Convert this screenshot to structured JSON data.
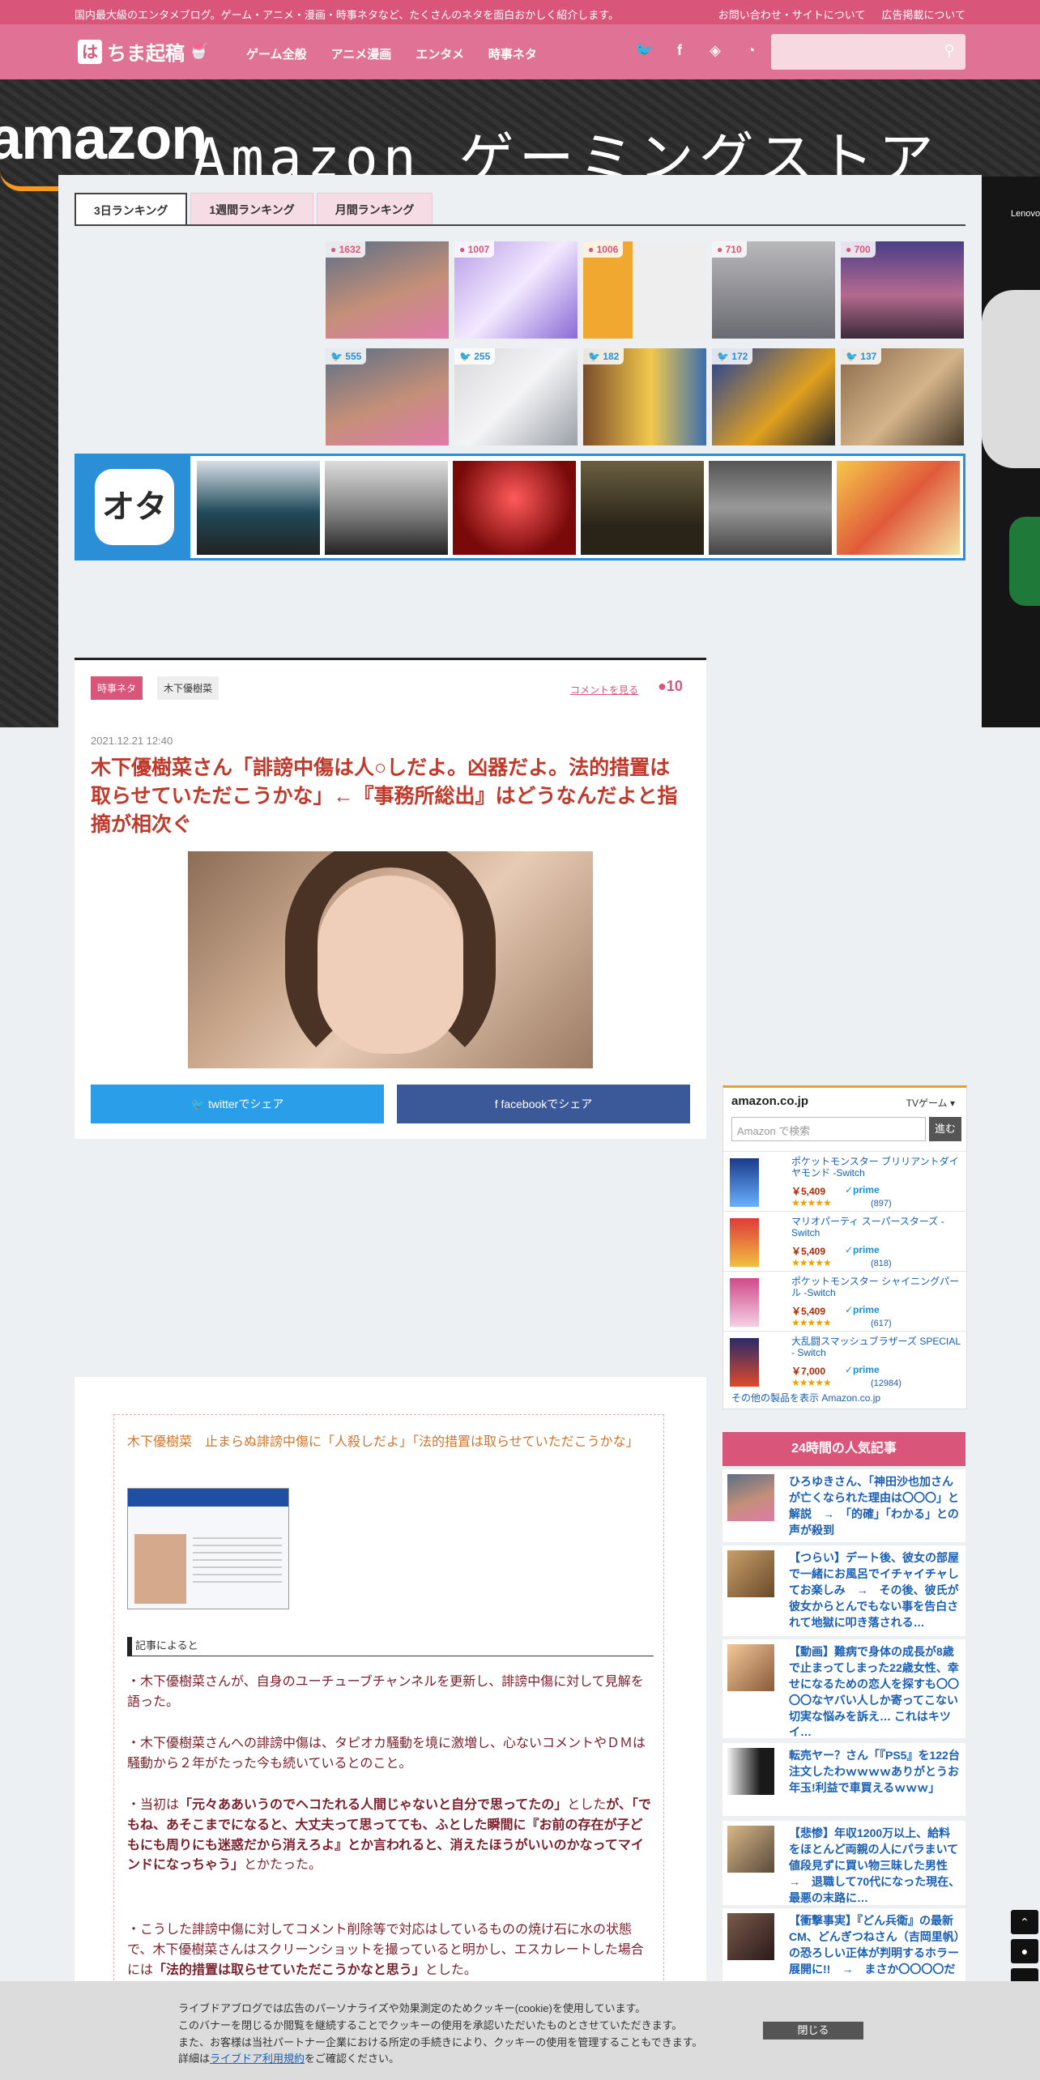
{
  "topbar": {
    "tagline": "国内最大級のエンタメブログ。ゲーム・アニメ・漫画・時事ネタなど、たくさんのネタを面白おかしく紹介します。",
    "contact": "お問い合わせ・サイトについて",
    "ads": "広告掲載について"
  },
  "header": {
    "logo_mark": "は",
    "logo_text": "ちま起稿",
    "nav": [
      "ゲーム全般",
      "アニメ漫画",
      "エンタメ",
      "時事ネタ"
    ],
    "social": [
      "twitter-icon",
      "facebook-icon",
      "feedly-icon",
      "rss-icon"
    ],
    "search_placeholder": ""
  },
  "banner": {
    "brand": "amazon",
    "headline": "Amazon ゲーミングストア",
    "side_label": "Lenovo"
  },
  "ranking": {
    "tabs": [
      "3日ランキング",
      "1週間ランキング",
      "月間ランキング"
    ],
    "comment_counts": [
      "1632",
      "1007",
      "1006",
      "710",
      "700"
    ],
    "twitter_counts": [
      "555",
      "255",
      "182",
      "172",
      "137"
    ],
    "strip_brand": "オタ"
  },
  "article": {
    "categories": [
      "時事ネタ",
      "木下優樹菜"
    ],
    "comment_link": "コメントを見る",
    "comment_count": "10",
    "date": "2021.12.21 12:40",
    "title": "木下優樹菜さん「誹謗中傷は人○しだよ。凶器だよ。法的措置は取らせていただこうかな」←『事務所総出』はどうなんだよと指摘が相次ぐ",
    "share_twitter": "twitterでシェア",
    "share_facebook": "facebookでシェア"
  },
  "body": {
    "quote_title": "木下優樹菜　止まらぬ誹謗中傷に「人殺しだよ」「法的措置は取らせていただこうかな」",
    "kiji_label": "記事によると",
    "p1": "・木下優樹菜さんが、自身のユーチューブチャンネルを更新し、誹謗中傷に対して見解を語った。",
    "p2": "・木下優樹菜さんへの誹謗中傷は、タピオカ騒動を境に激増し、心ないコメントやＤＭは騒動から２年がたった今も続いているとのこと。",
    "p3a": "・当初は",
    "p3b": "「元々ああいうのでヘコたれる人間じゃないと自分で思ってたの」",
    "p3c": "とした",
    "p3d": "が、「でもね、あそこまでになると、大丈夫って思ってても、ふとした瞬間に『お前の存在が子どもにも周りにも迷惑だから消えろよ』とか言われると、消えたほうがいいのかなってマインドになっちゃう」",
    "p3e": "とかたった。",
    "p4a": "・こうした誹謗中傷に対してコメント削除等で対応はしているものの焼け石に水の状態で、木下優樹菜さんはスクリーンショットを撮っていると明かし、エスカレートした場合には",
    "p4b": "「法的措置は取らせていただこうかなと思う」",
    "p4c": "とした。"
  },
  "amazon": {
    "logo": "amazon.co.jp",
    "category": "TVゲーム",
    "search_placeholder": "Amazon で検索",
    "search_button": "進む",
    "items": [
      {
        "name": "ポケットモンスター ブリリアントダイヤモンド -Switch",
        "price": "￥5,409",
        "prime": "✓prime",
        "stars": "★★★★★",
        "reviews": "(897)"
      },
      {
        "name": "マリオパーティ スーパースターズ -Switch",
        "price": "￥5,409",
        "prime": "✓prime",
        "stars": "★★★★★",
        "reviews": "(818)"
      },
      {
        "name": "ポケットモンスター シャイニングパール -Switch",
        "price": "￥5,409",
        "prime": "✓prime",
        "stars": "★★★★★",
        "reviews": "(617)"
      },
      {
        "name": "大乱闘スマッシュブラザーズ SPECIAL - Switch",
        "price": "￥7,000",
        "prime": "✓prime",
        "stars": "★★★★★",
        "reviews": "(12984)"
      }
    ],
    "more": "その他の製品を表示 Amazon.co.jp"
  },
  "popular": {
    "heading": "24時間の人気記事",
    "items": [
      "ひろゆきさん、「神田沙也加さんが亡くなられた理由は〇〇〇」と解説　→　「的確」「わかる」との声が殺到",
      "【つらい】デート後、彼女の部屋で一緒にお風呂でイチャイチャしてお楽しみ　→　その後、彼氏が彼女からとんでもない事を告白されて地獄に叩き落される…",
      "【動画】難病で身体の成長が8歳で止まってしまった22歳女性、幸せになるための恋人を探すも〇〇〇〇なヤバい人しか寄ってこない切実な悩みを訴え… これはキツイ…",
      "転売ヤー？さん「『PS5』を122台注文したわｗｗｗｗありがとうお年玉!利益で車買えるｗｗｗ」",
      "【悲惨】年収1200万以上、給料をほとんど両親の人にパラまいて値段見ずに買い物三昧した男性　→　退職して70代になった現在、最悪の末路に…",
      "【衝撃事実】『どん兵衛』の最新CM、どんぎつねさん（吉岡里帆）の恐ろしい正体が判明するホラー展開に!!　→　まさか〇〇〇〇だったとは…"
    ]
  },
  "cookie": {
    "line1": "ライブドアブログでは広告のパーソナライズや効果測定のためクッキー(cookie)を使用しています。",
    "line2": "このバナーを閉じるか閲覧を継続することでクッキーの使用を承認いただいたものとさせていただきます。",
    "line3": "また、お客様は当社パートナー企業における所定の手続きにより、クッキーの使用を管理することもできます。",
    "line4a": "詳細は",
    "line4b": "ライブドア利用規約",
    "line4c": "をご確認ください。",
    "close": "閉じる"
  },
  "fab": [
    "chevron-up-icon",
    "comment-icon",
    "chevron-down-icon"
  ]
}
